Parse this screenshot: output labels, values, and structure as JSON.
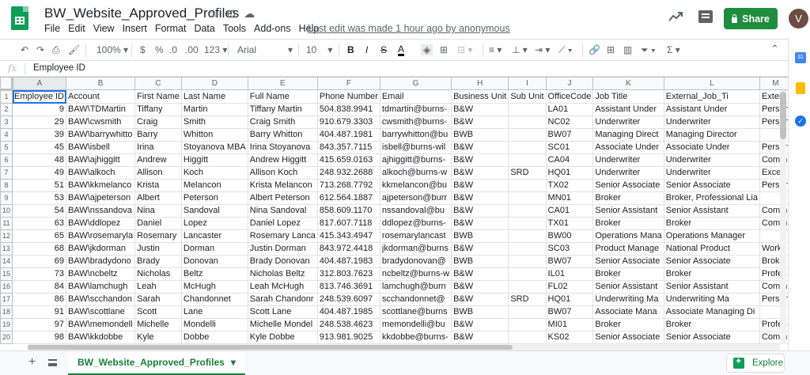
{
  "window": {
    "doc_title": "BW_Website_Approved_Profiles",
    "last_edit": "Last edit was made 1 hour ago by anonymous",
    "share_label": "Share",
    "avatar_initial": "V"
  },
  "menu": [
    "File",
    "Edit",
    "View",
    "Insert",
    "Format",
    "Data",
    "Tools",
    "Add-ons",
    "Help"
  ],
  "toolbar": {
    "zoom": "100%",
    "currency": "$",
    "percent": "%",
    "dec_less": ".0",
    "dec_more": ".00",
    "format": "123",
    "font": "Arial",
    "font_size": "10"
  },
  "formula_bar": {
    "fx": "fx",
    "content": "Employee ID"
  },
  "grid": {
    "columns": [
      "A",
      "B",
      "C",
      "D",
      "E",
      "F",
      "G",
      "H",
      "I",
      "J",
      "K",
      "L",
      "M"
    ],
    "rows": [
      [
        "Employee ID",
        "Account",
        "First Name",
        "Last Name",
        "Full Name",
        "Phone Number",
        "Email",
        "Business Unit",
        "Sub Unit",
        "OfficeCode",
        "Job Title",
        "External_Job_Ti",
        "Extern"
      ],
      [
        "9",
        "BAW\\TDMartin",
        "Tiffany",
        "Martin",
        "Tiffany Martin",
        "504.838.9941",
        "tdmartin@burns-",
        "B&W",
        "",
        "LA01",
        "Assistant Under",
        "Assistant Under",
        "Person"
      ],
      [
        "29",
        "BAW\\cwsmith",
        "Craig",
        "Smith",
        "Craig Smith",
        "910.679.3303",
        "cwsmith@burns-",
        "B&W",
        "",
        "NC02",
        "Underwriter",
        "Underwriter",
        "Person"
      ],
      [
        "39",
        "BAW\\barrywhitto",
        "Barry",
        "Whitton",
        "Barry Whitton",
        "404.487.1981",
        "barrywhitton@bu",
        "BWB",
        "",
        "BW07",
        "Managing Direct",
        "Managing Director",
        ""
      ],
      [
        "45",
        "BAW\\isbell",
        "Irina",
        "Stoyanova MBA",
        "Irina Stoyanova",
        "843.357.7115",
        "isbell@burns-wil",
        "B&W",
        "",
        "SC01",
        "Associate Under",
        "Associate Under",
        "Person"
      ],
      [
        "48",
        "BAW\\ajhiggitt",
        "Andrew",
        "Higgitt",
        "Andrew Higgitt",
        "415.659.0163",
        "ajhiggitt@burns-",
        "B&W",
        "",
        "CA04",
        "Underwriter",
        "Underwriter",
        "Comm"
      ],
      [
        "49",
        "BAW\\alkoch",
        "Allison",
        "Koch",
        "Allison Koch",
        "248.932.2688",
        "alkoch@burns-w",
        "B&W",
        "SRD",
        "HQ01",
        "Underwriter",
        "Underwriter",
        "Exces"
      ],
      [
        "51",
        "BAW\\kkmelanco",
        "Krista",
        "Melancon",
        "Krista Melancon",
        "713.268.7792",
        "kkmelancon@bu",
        "B&W",
        "",
        "TX02",
        "Senior Associate",
        "Senior Associate",
        "Person"
      ],
      [
        "53",
        "BAW\\ajpeterson",
        "Albert",
        "Peterson",
        "Albert Peterson",
        "612.564.1887",
        "ajpeterson@burr",
        "B&W",
        "",
        "MN01",
        "Broker",
        "Broker, Professional Lia",
        ""
      ],
      [
        "54",
        "BAW\\nssandova",
        "Nina",
        "Sandoval",
        "Nina Sandoval",
        "858.609.1170",
        "nssandoval@bu",
        "B&W",
        "",
        "CA01",
        "Senior Assistant",
        "Senior Assistant",
        "Comm"
      ],
      [
        "63",
        "BAW\\ddlopez",
        "Daniel",
        "Lopez",
        "Daniel Lopez",
        "817.607.7118",
        "ddlopez@burns-",
        "B&W",
        "",
        "TX01",
        "Broker",
        "Broker",
        "Comm"
      ],
      [
        "65",
        "BAW\\rosemaryla",
        "Rosemary",
        "Lancaster",
        "Rosemary Lanca",
        "415.343.4947",
        "rosemarylancast",
        "BWB",
        "",
        "BW00",
        "Operations Mana",
        "Operations Manager",
        ""
      ],
      [
        "68",
        "BAW\\jkdorman",
        "Justin",
        "Dorman",
        "Justin Dorman",
        "843.972.4418",
        "jkdorman@burns",
        "B&W",
        "",
        "SC03",
        "Product Manage",
        "National Product",
        "Worke"
      ],
      [
        "69",
        "BAW\\bradydono",
        "Brady",
        "Donovan",
        "Brady Donovan",
        "404.487.1983",
        "bradydonovan@",
        "BWB",
        "",
        "BW07",
        "Senior Associate",
        "Senior Associate",
        "Broke"
      ],
      [
        "73",
        "BAW\\ncbeltz",
        "Nicholas",
        "Beltz",
        "Nicholas Beltz",
        "312.803.7623",
        "ncbeltz@burns-w",
        "B&W",
        "",
        "IL01",
        "Broker",
        "Broker",
        "Profes"
      ],
      [
        "84",
        "BAW\\lamchugh",
        "Leah",
        "McHugh",
        "Leah McHugh",
        "813.746.3691",
        "lamchugh@burn",
        "B&W",
        "",
        "FL02",
        "Senior Assistant",
        "Senior Assistant",
        "Comm"
      ],
      [
        "86",
        "BAW\\scchandon",
        "Sarah",
        "Chandonnet",
        "Sarah Chandonr",
        "248.539.6097",
        "scchandonnet@",
        "B&W",
        "SRD",
        "HQ01",
        "Underwriting Ma",
        "Underwriting Ma",
        "Person"
      ],
      [
        "91",
        "BAW\\scottlane",
        "Scott",
        "Lane",
        "Scott Lane",
        "404.487.1985",
        "scottlane@burns",
        "BWB",
        "",
        "BW07",
        "Associate Mana",
        "Associate Managing Di",
        ""
      ],
      [
        "97",
        "BAW\\memondell",
        "Michelle",
        "Mondelli",
        "Michelle Mondel",
        "248.538.4623",
        "memondelli@bu",
        "B&W",
        "",
        "MI01",
        "Broker",
        "Broker",
        "Profes"
      ],
      [
        "98",
        "BAW\\kkdobbe",
        "Kyle",
        "Dobbe",
        "Kyle Dobbe",
        "913.981.9025",
        "kkdobbe@burns-",
        "B&W",
        "",
        "KS02",
        "Senior Associate",
        "Senior Associate",
        "Comm"
      ]
    ]
  },
  "sheet_tab": "BW_Website_Approved_Profiles",
  "explore_label": "Explore"
}
